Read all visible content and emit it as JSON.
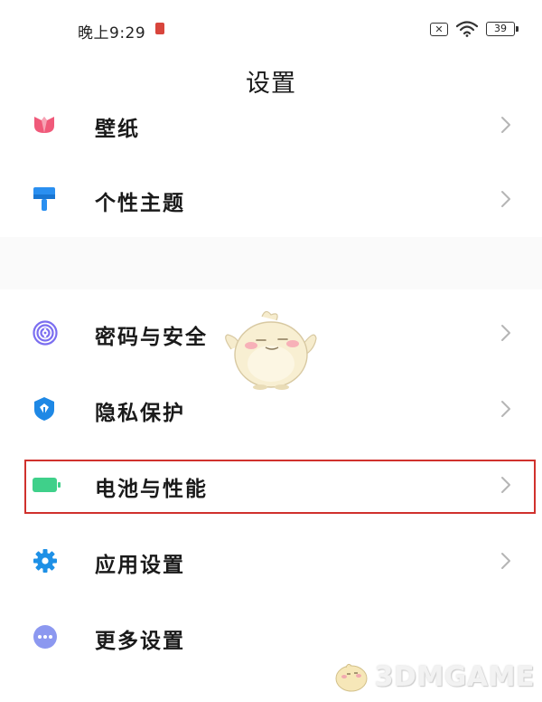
{
  "status_bar": {
    "time": "晚上9:29",
    "battery_level": "39",
    "sim_status": "✕"
  },
  "header": {
    "title": "设置"
  },
  "settings": {
    "items": [
      {
        "label": "壁纸",
        "icon": "wallpaper-icon",
        "color": "#f05a7a"
      },
      {
        "label": "个性主题",
        "icon": "theme-brush-icon",
        "color": "#2a8ff0"
      },
      {
        "label": "密码与安全",
        "icon": "fingerprint-icon",
        "color": "#7b6ef0"
      },
      {
        "label": "隐私保护",
        "icon": "privacy-shield-icon",
        "color": "#1e88e5"
      },
      {
        "label": "电池与性能",
        "icon": "battery-icon",
        "color": "#3fd08a"
      },
      {
        "label": "应用设置",
        "icon": "gear-icon",
        "color": "#1e90e6"
      },
      {
        "label": "更多设置",
        "icon": "more-dots-icon",
        "color": "#8c98f0"
      }
    ],
    "highlighted_item": "电池与性能"
  },
  "watermark": {
    "text": "3DMGAME"
  }
}
